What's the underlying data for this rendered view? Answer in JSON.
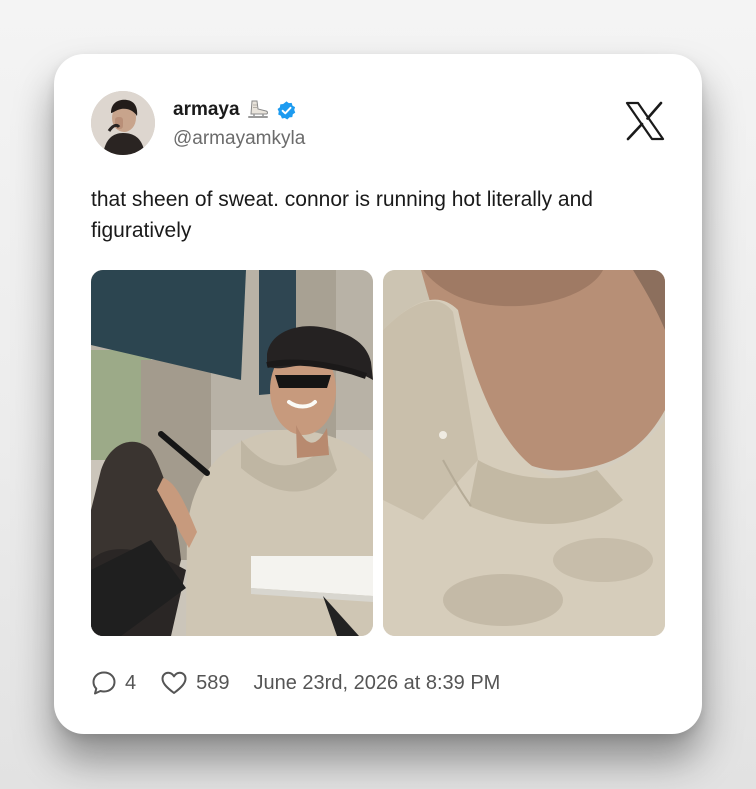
{
  "tweet": {
    "display_name": "armaya",
    "name_emoji_icon": "ice-skate-icon",
    "verified_icon": "verified-badge-icon",
    "handle": "@armayamkyla",
    "brand_icon": "x-logo-icon",
    "text": "that sheen of sweat. connor is running hot literally and figuratively",
    "media": [
      {
        "icon": "photo"
      },
      {
        "icon": "photo"
      }
    ],
    "stats": {
      "replies_icon": "comment-bubble-icon",
      "replies": "4",
      "likes_icon": "heart-icon",
      "likes": "589"
    },
    "timestamp": "June 23rd, 2026 at 8:39 PM"
  },
  "colors": {
    "background": "#efefef",
    "card": "#ffffff",
    "text_primary": "#1a1a1a",
    "text_secondary": "#6b6b6b",
    "verified_blue": "#1d9bf0"
  }
}
